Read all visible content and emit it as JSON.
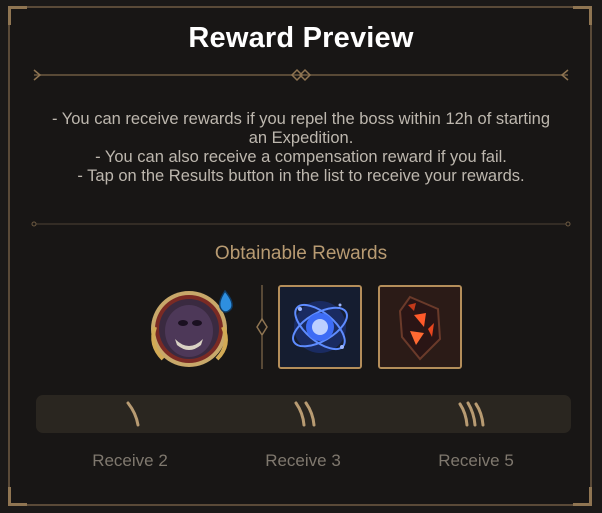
{
  "dialog": {
    "title": "Reward Preview",
    "description": [
      "- You can receive rewards if you repel the boss within 12h of starting an Expedition.",
      "- You can also receive a compensation reward if you fail.",
      "- Tap on the Results button in the list to receive your rewards."
    ],
    "subtitle": "Obtainable Rewards"
  },
  "rewards": [
    {
      "icon": "boss-portrait-icon"
    },
    {
      "icon": "blue-rune-orb-icon"
    },
    {
      "icon": "red-crystal-shard-icon"
    }
  ],
  "tiers": [
    {
      "label": "Receive 2",
      "claws": 1
    },
    {
      "label": "Receive 3",
      "claws": 2
    },
    {
      "label": "Receive 5",
      "claws": 3
    }
  ],
  "colors": {
    "accent": "#b89b72",
    "frame": "#b48e5a",
    "text": "#bdb7ae"
  }
}
